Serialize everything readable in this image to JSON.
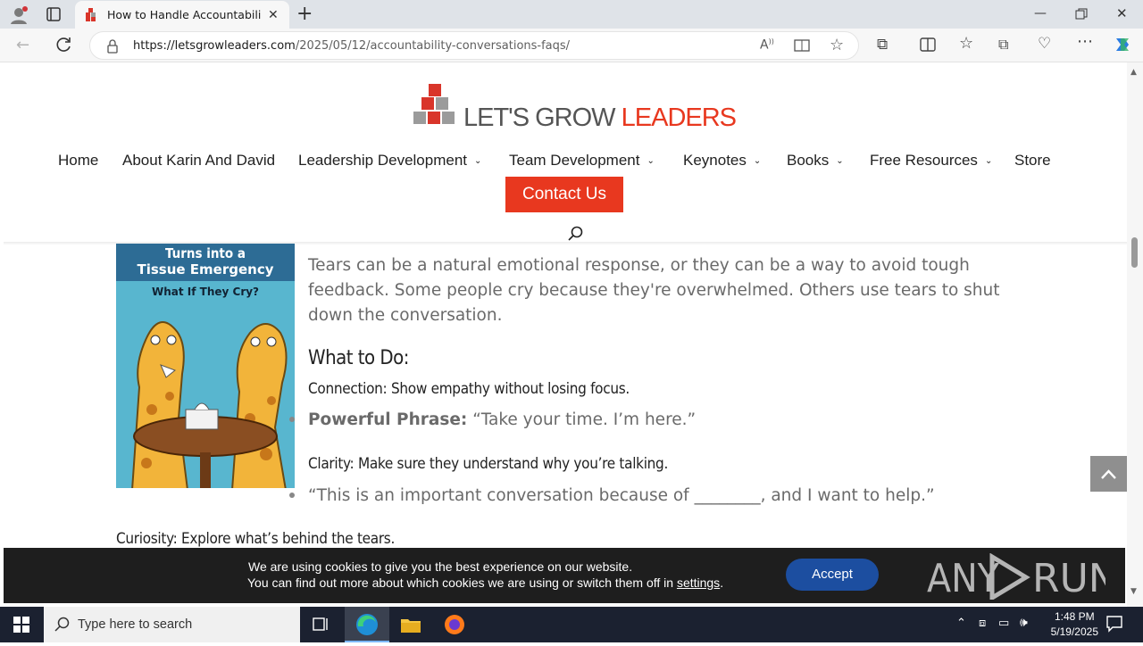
{
  "browser": {
    "tab_title": "How to Handle Accountability C",
    "url_domain": "https://letsgrowleaders.com",
    "url_path": "/2025/05/12/accountability-conversations-faqs/"
  },
  "site": {
    "logo_text_a": "LET'S GROW",
    "logo_text_b": "LEADERS",
    "nav": [
      "Home",
      "About Karin And David",
      "Leadership Development",
      "Team Development",
      "Keynotes",
      "Books",
      "Free Resources",
      "Store"
    ],
    "contact_label": "Contact Us"
  },
  "article": {
    "image_title_1": "Turns into a",
    "image_title_2": "Tissue Emergency",
    "image_subtitle": "What If They Cry?",
    "para_1": "Tears can be a natural emotional response, or they can be a way to avoid tough",
    "para_2": "feedback. Some people cry because they're overwhelmed. Others use tears to shut",
    "para_3": "down the conversation.",
    "what_to_do": "What to Do:",
    "connection": "Connection: Show empathy without losing focus.",
    "powerful_label": "Powerful Phrase:",
    "powerful_text": " “Take your time. I’m here.”",
    "clarity": "Clarity: Make sure they understand why you’re talking.",
    "clarity_quote": "“This is an important conversation because of ________, and I want to help.”",
    "curiosity": "Curiosity: Explore what’s behind the tears."
  },
  "cookie": {
    "line_1": "We are using cookies to give you the best experience on our website.",
    "line_2_a": "You can find out more about which cookies we are using or switch them off in ",
    "line_2_link": "settings",
    "line_2_b": ".",
    "accept": "Accept"
  },
  "watermark": "ANY RUN",
  "taskbar": {
    "search_placeholder": "Type here to search",
    "time": "1:48 PM",
    "date": "5/19/2025"
  },
  "colors": {
    "brand_red": "#e8381f",
    "accept_blue": "#1c4ea0"
  }
}
